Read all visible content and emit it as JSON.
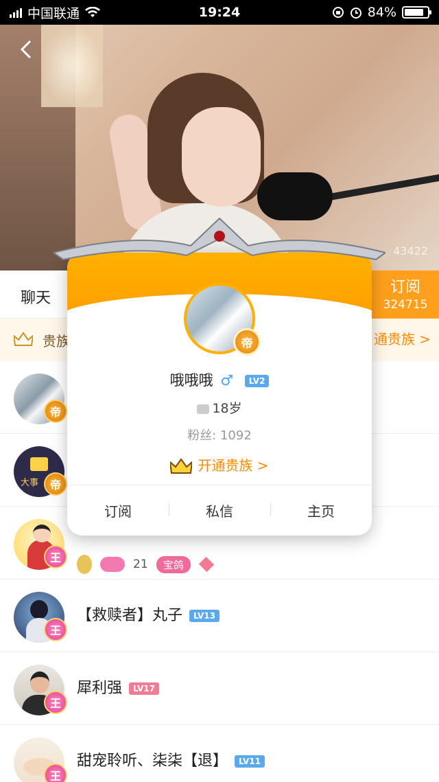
{
  "status_bar": {
    "carrier": "中国联通",
    "time": "19:24",
    "battery_percent": "84%",
    "battery_level": 0.84
  },
  "stream": {
    "watermark": "43422"
  },
  "room": {
    "chat_tab": "聊天",
    "subscribe_label": "订阅",
    "subscriber_count": "324715",
    "noble_label": "贵族",
    "noble_link": "通贵族 >"
  },
  "viewers": [
    {
      "name": "",
      "badge": "帝",
      "badge_type": "emperor",
      "level": ""
    },
    {
      "name": "",
      "badge": "帝",
      "badge_type": "emperor",
      "level": "",
      "avatar_text": "大事"
    },
    {
      "name": "",
      "badge": "王",
      "badge_type": "king",
      "level": "",
      "badge_count": "21",
      "pill": "宝鸽"
    },
    {
      "name": "【救赎者】丸子",
      "badge": "王",
      "badge_type": "king",
      "level": "LV13",
      "level_color": "blue"
    },
    {
      "name": "犀利强",
      "badge": "王",
      "badge_type": "king",
      "level": "LV17",
      "level_color": "pink"
    },
    {
      "name": "甜宠聆听、柒柒【退】",
      "badge": "王",
      "badge_type": "king",
      "level": "LV11",
      "level_color": "blue"
    }
  ],
  "popup": {
    "badge": "帝",
    "name": "哦哦哦",
    "gender_symbol": "♂",
    "level": "LV2",
    "age": "18岁",
    "fans": "粉丝: 1092",
    "open_noble": "开通贵族 >",
    "actions": {
      "subscribe": "订阅",
      "message": "私信",
      "homepage": "主页"
    }
  },
  "colors": {
    "accent_orange": "#ff9f1c",
    "level_blue": "#5aa9ec",
    "level_pink": "#f27a95"
  }
}
